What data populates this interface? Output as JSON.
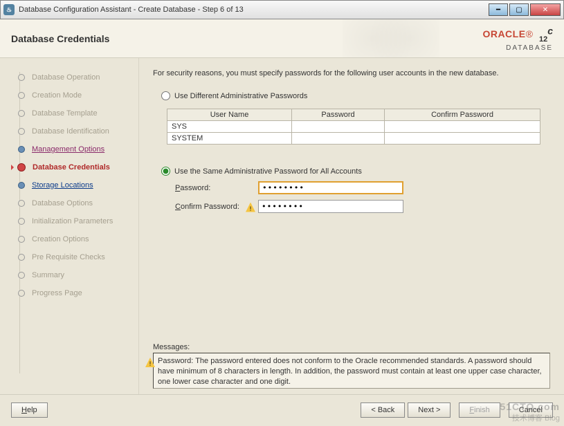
{
  "window": {
    "title": "Database Configuration Assistant - Create Database - Step 6 of 13"
  },
  "banner": {
    "heading": "Database Credentials",
    "brand": "ORACLE",
    "version_main": "12",
    "version_sup": "c",
    "product": "DATABASE"
  },
  "steps": [
    {
      "label": "Database Operation",
      "state": "plain"
    },
    {
      "label": "Creation Mode",
      "state": "plain"
    },
    {
      "label": "Database Template",
      "state": "plain"
    },
    {
      "label": "Database Identification",
      "state": "plain"
    },
    {
      "label": "Management Options",
      "state": "linkm"
    },
    {
      "label": "Database Credentials",
      "state": "current"
    },
    {
      "label": "Storage Locations",
      "state": "link"
    },
    {
      "label": "Database Options",
      "state": "plain"
    },
    {
      "label": "Initialization Parameters",
      "state": "plain"
    },
    {
      "label": "Creation Options",
      "state": "plain"
    },
    {
      "label": "Pre Requisite Checks",
      "state": "plain"
    },
    {
      "label": "Summary",
      "state": "plain"
    },
    {
      "label": "Progress Page",
      "state": "plain"
    }
  ],
  "content": {
    "info": "For security reasons, you must specify passwords for the following user accounts in the new database.",
    "radio_different": "Use Different Administrative Passwords",
    "table": {
      "headers": [
        "User Name",
        "Password",
        "Confirm Password"
      ],
      "rows": [
        {
          "user": "SYS"
        },
        {
          "user": "SYSTEM"
        }
      ]
    },
    "radio_same": "Use the Same Administrative Password for All Accounts",
    "password_label": "Password:",
    "confirm_label": "Confirm Password:",
    "password_value": "••••••••",
    "confirm_value": "••••••••",
    "messages_label": "Messages:",
    "message_text": "Password: The password entered does not conform to the Oracle recommended standards. A password should have minimum of 8 characters in length. In addition, the password must contain at least one upper case character, one lower case character and one digit."
  },
  "footer": {
    "help": "Help",
    "back": "< Back",
    "next": "Next >",
    "finish": "Finish",
    "cancel": "Cancel"
  },
  "watermark": {
    "line1": "51CTO.com",
    "line2": "技术博客  Blog"
  }
}
